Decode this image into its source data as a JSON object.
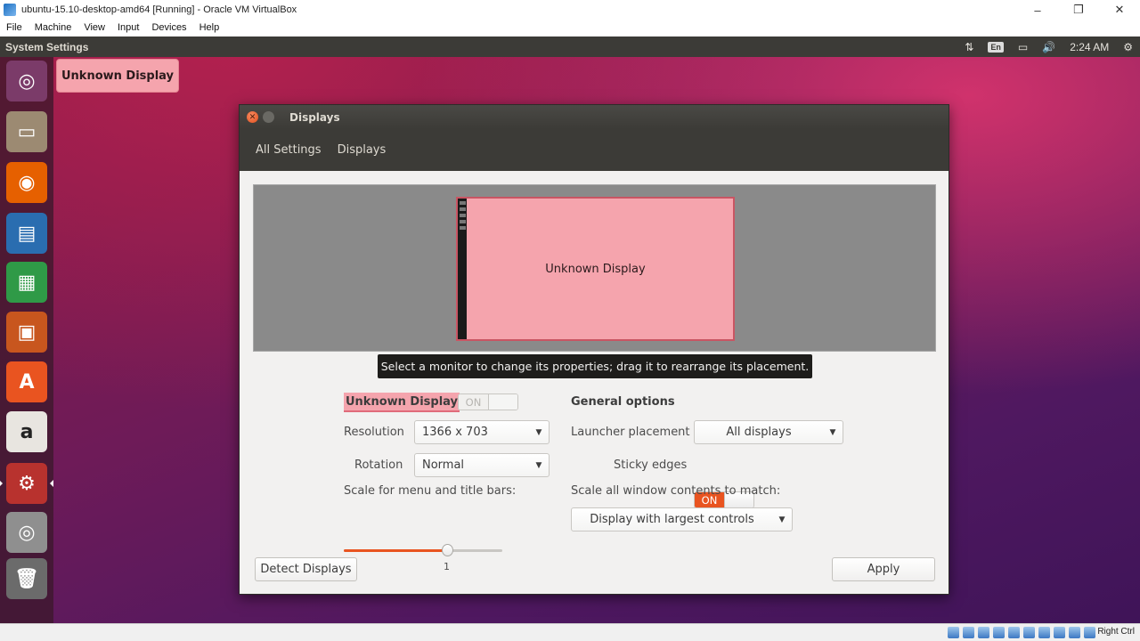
{
  "host": {
    "window_title": "ubuntu-15.10-desktop-amd64 [Running] - Oracle VM VirtualBox",
    "window_controls": {
      "minimize": "–",
      "maximize": "❐",
      "close": "✕"
    },
    "menu": [
      "File",
      "Machine",
      "View",
      "Input",
      "Devices",
      "Help"
    ],
    "host_key": "Right Ctrl"
  },
  "panel": {
    "title": "System Settings",
    "indicators": {
      "network": "⇅",
      "keyboard": "En",
      "battery": "▭",
      "volume": "🔊",
      "clock": "2:24 AM",
      "settings": "⚙"
    }
  },
  "launcher": {
    "items": [
      {
        "name": "dash-home",
        "glyph": "◎",
        "color": "#7b3b69"
      },
      {
        "name": "files",
        "glyph": "▭",
        "color": "#9c8a72"
      },
      {
        "name": "firefox",
        "glyph": "◉",
        "color": "#e66000"
      },
      {
        "name": "libreoffice-writer",
        "glyph": "▤",
        "color": "#2a6db0"
      },
      {
        "name": "libreoffice-calc",
        "glyph": "▦",
        "color": "#2f9a47"
      },
      {
        "name": "libreoffice-impress",
        "glyph": "▣",
        "color": "#c8561e"
      },
      {
        "name": "ubuntu-software-center",
        "glyph": "A",
        "color": "#e95420"
      },
      {
        "name": "amazon",
        "glyph": "a",
        "color": "#e8e5e0"
      },
      {
        "name": "system-settings",
        "glyph": "⚙",
        "color": "#b8322e"
      },
      {
        "name": "dvd",
        "glyph": "◎",
        "color": "#8f8f8f"
      },
      {
        "name": "trash",
        "glyph": "🗑",
        "color": "#6b6b6b"
      }
    ]
  },
  "identify_label": "Unknown Display",
  "displays_window": {
    "title": "Displays",
    "close_glyph": "✕",
    "breadcrumb": [
      "All Settings",
      "Displays"
    ],
    "monitor_label": "Unknown Display",
    "tooltip": "Select a monitor to change its properties; drag it to rearrange its placement.",
    "display": {
      "name": "Unknown Display",
      "switch_label": "ON",
      "resolution_label": "Resolution",
      "resolution_value": "1366 x 703",
      "rotation_label": "Rotation",
      "rotation_value": "Normal",
      "scale_label": "Scale for menu and title bars:",
      "scale_value": "1",
      "scale_fraction": 0.65
    },
    "general": {
      "heading": "General options",
      "launcher_label": "Launcher placement",
      "launcher_value": "All displays",
      "sticky_label": "Sticky edges",
      "sticky_value": "ON",
      "scale_all_label": "Scale all window contents to match:",
      "scale_all_value": "Display with largest controls"
    },
    "detect_button": "Detect Displays",
    "apply_button": "Apply",
    "dropdown_arrow": "▼"
  }
}
